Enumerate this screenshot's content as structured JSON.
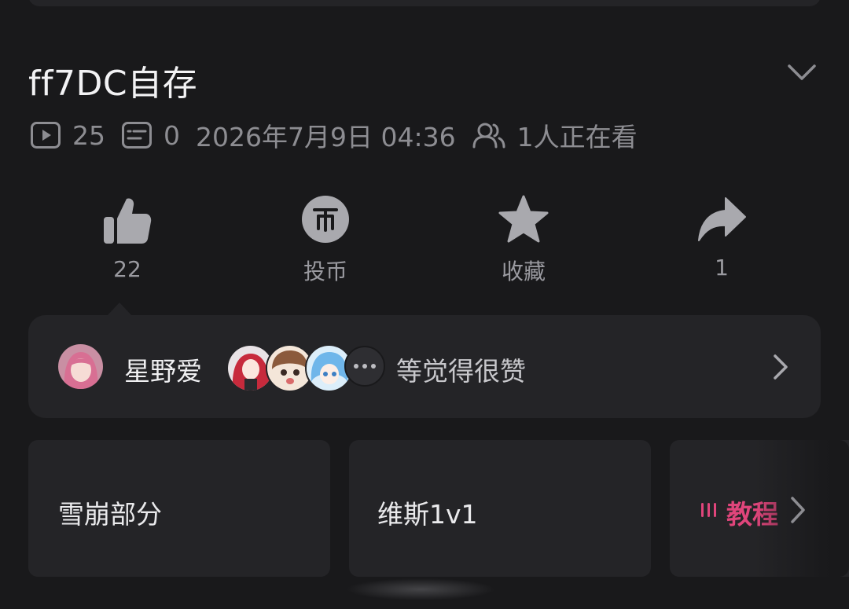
{
  "video": {
    "title": "ff7DC自存",
    "views": "25",
    "danmaku": "0",
    "date": "2026年7月9日 04:36",
    "watching": "1人正在看"
  },
  "actions": {
    "like": "22",
    "coin": "投币",
    "favorite": "收藏",
    "share": "1"
  },
  "likers": {
    "name": "星野爱",
    "suffix": "等觉得很赞"
  },
  "episodes": [
    {
      "label": "雪崩部分"
    },
    {
      "label": "维斯1v1"
    },
    {
      "label": "教程",
      "active": true
    }
  ],
  "colors": {
    "background": "#19191b",
    "card": "#242427",
    "accent": "#e0457b",
    "muted": "#8d8d92"
  },
  "icons": [
    "play-icon",
    "danmaku-icon",
    "watching-icon",
    "thumbs-up-icon",
    "coin-icon",
    "star-icon",
    "share-icon",
    "chevron-down-icon",
    "chevron-right-icon",
    "playing-bars-icon"
  ]
}
